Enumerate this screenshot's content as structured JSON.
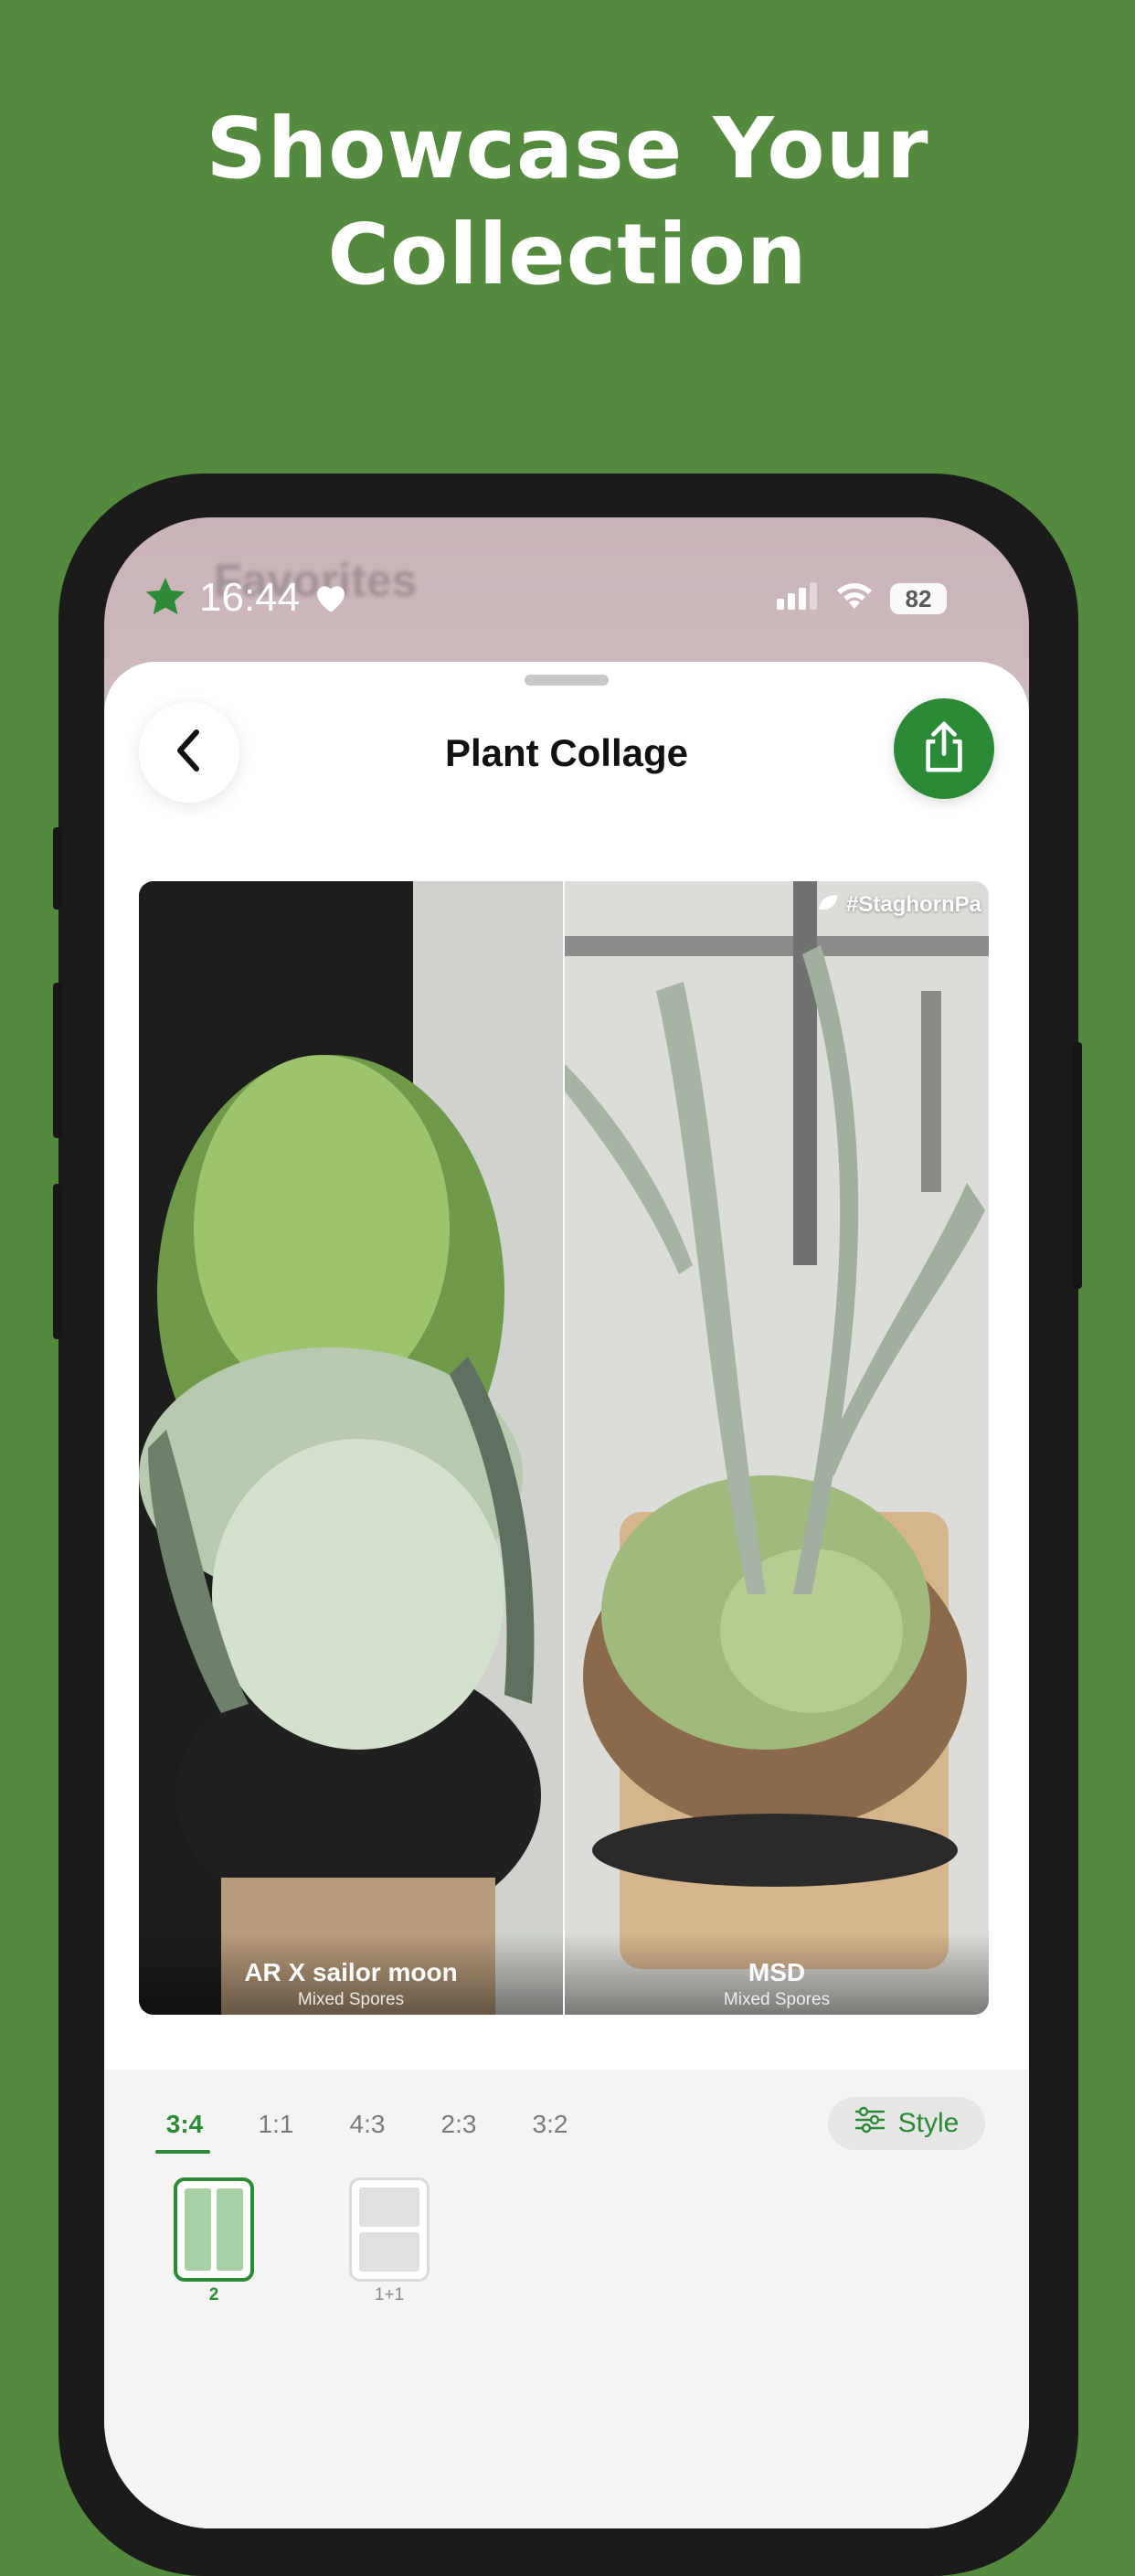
{
  "promo": {
    "headline_line1": "Showcase Your",
    "headline_line2": "Collection"
  },
  "status_bar": {
    "time": "16:44",
    "battery": "82"
  },
  "background_text": "Favorites",
  "header": {
    "title": "Plant Collage"
  },
  "collage": {
    "watermark": "#StaghornPa",
    "panels": [
      {
        "name": "AR X sailor moon",
        "subtitle": "Mixed Spores"
      },
      {
        "name": "MSD",
        "subtitle": "Mixed Spores"
      }
    ]
  },
  "aspect_ratios": {
    "selected": "3:4",
    "items": [
      "3:4",
      "1:1",
      "4:3",
      "2:3",
      "3:2"
    ]
  },
  "style_button": {
    "label": "Style"
  },
  "layouts": [
    {
      "label": "2",
      "selected": true
    },
    {
      "label": "1+1",
      "selected": false
    }
  ],
  "colors": {
    "brand_green": "#2a8a35",
    "promo_background": "#548a3e"
  }
}
